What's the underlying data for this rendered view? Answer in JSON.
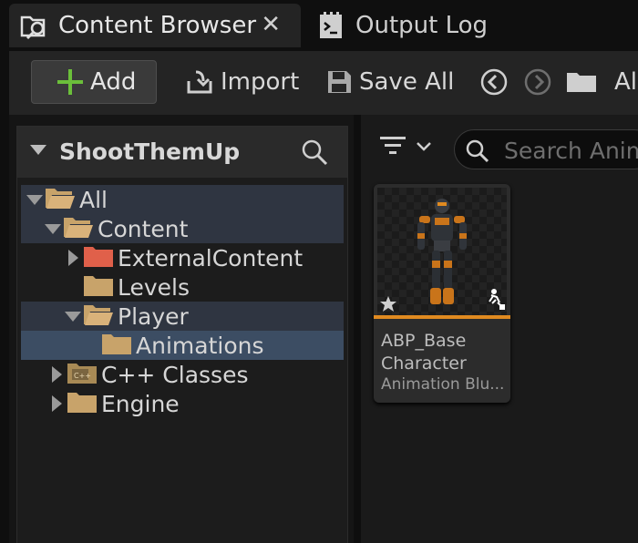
{
  "tabs": [
    {
      "label": "Content Browser",
      "icon": "content-browser-icon",
      "active": true
    },
    {
      "label": "Output Log",
      "icon": "output-log-icon",
      "active": false
    }
  ],
  "toolbar": {
    "add_label": "Add",
    "import_label": "Import",
    "save_all_label": "Save All",
    "path_partial": "All"
  },
  "left_panel": {
    "title": "ShootThemUp",
    "tree": [
      {
        "label": "All",
        "expanded": true
      },
      {
        "label": "Content",
        "expanded": true
      },
      {
        "label": "ExternalContent",
        "expanded": false
      },
      {
        "label": "Levels"
      },
      {
        "label": "Player",
        "expanded": true
      },
      {
        "label": "Animations",
        "selected": true
      },
      {
        "label": "C++ Classes",
        "expanded": false,
        "icon": "cpp-folder-icon"
      },
      {
        "label": "Engine",
        "expanded": false
      }
    ]
  },
  "search": {
    "placeholder": "Search Animations"
  },
  "assets": [
    {
      "name": "ABP_Base Character",
      "type": "Animation Blu...",
      "badge": "animation-blueprint-icon"
    }
  ],
  "colors": {
    "accent_add": "#6bbf3a",
    "folder": "#c8a36a",
    "external_folder": "#e0604a",
    "asset_bar": "#e08a20",
    "selection": "#3c4d63"
  }
}
